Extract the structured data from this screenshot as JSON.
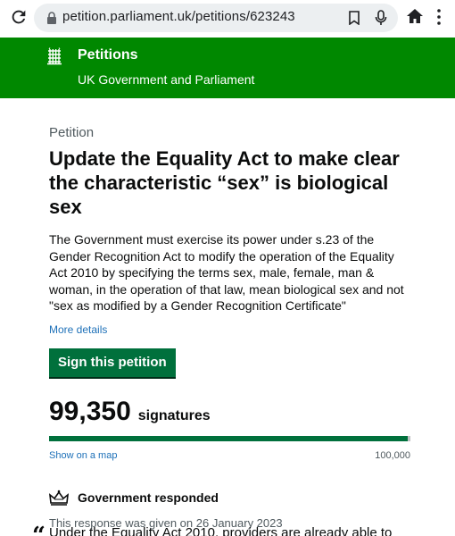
{
  "browser": {
    "url": "petition.parliament.uk/petitions/623243"
  },
  "header": {
    "title": "Petitions",
    "subtitle": "UK Government and Parliament"
  },
  "petition": {
    "caption": "Petition",
    "title": "Update the Equality Act to make clear the characteristic “sex” is biological sex",
    "summary": "The Government must exercise its power under s.23 of the Gender Recognition Act to modify the operation of the Equality Act 2010 by specifying the terms sex, male, female, man & woman, in the operation of that law, mean biological sex and not \"sex as modified by a Gender Recognition Certificate\"",
    "more_details": "More details",
    "sign_label": "Sign this petition",
    "signature_count": "99,350",
    "signatures_label": "signatures",
    "progress_fraction": 0.9935,
    "map_link": "Show on a map",
    "goal": "100,000"
  },
  "response": {
    "title": "Government responded",
    "given": "This response was given on 26 January 2023",
    "quote_mark": "“",
    "quote_start": "Under the Equality Act 2010, providers are already able to"
  },
  "colors": {
    "header_green": "#008800",
    "button_green": "#00703c",
    "link_blue": "#1d70b8"
  }
}
